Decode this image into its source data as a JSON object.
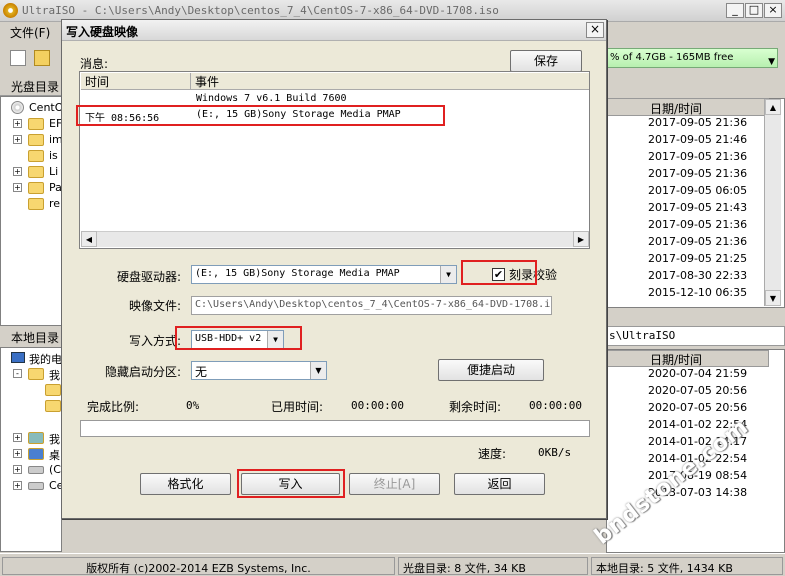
{
  "app": {
    "title": "UltraISO - C:\\Users\\Andy\\Desktop\\centos_7_4\\CentOS-7-x86_64-DVD-1708.iso",
    "menu_file": "文件(F)",
    "window_buttons": [
      "_",
      "□",
      "×"
    ]
  },
  "capacity": {
    "text": "% of 4.7GB - 165MB free",
    "level": 0.96
  },
  "left_top": {
    "header": "光盘目录",
    "root": "CentO",
    "items": [
      "EF",
      "im",
      "is",
      "Li",
      "Pa",
      "re"
    ]
  },
  "left_bottom": {
    "header": "本地目录",
    "items": [
      "我的电",
      "我",
      "",
      "",
      "我",
      "桌",
      "(C",
      "Ce"
    ]
  },
  "right_top": {
    "header": "日期/时间",
    "dates": [
      "2017-09-05 21:36",
      "2017-09-05 21:46",
      "2017-09-05 21:36",
      "2017-09-05 21:36",
      "2017-09-05 06:05",
      "2017-09-05 21:43",
      "2017-09-05 21:36",
      "2017-09-05 21:36",
      "2017-09-05 21:25",
      "2017-08-30 22:33",
      "2015-12-10 06:35"
    ]
  },
  "right_bottom": {
    "path": "s\\UltraISO",
    "header": "日期/时间",
    "dates": [
      "2020-07-04 21:59",
      "2020-07-05 20:56",
      "2020-07-05 20:56",
      "2014-01-02 22:54",
      "2014-01-02 14:17",
      "2014-01-02 22:54",
      "2017-08-19 08:54",
      "2013-07-03 14:38"
    ]
  },
  "status": {
    "copyright": "版权所有 (c)2002-2014 EZB Systems, Inc.",
    "iso_dir": "光盘目录: 8 文件, 34 KB",
    "local_dir": "本地目录: 5 文件, 1434 KB"
  },
  "dialog": {
    "title": "写入硬盘映像",
    "close": "×",
    "messages_label": "消息:",
    "save_button": "保存",
    "log_columns": [
      "时间",
      "事件"
    ],
    "log_rows": [
      {
        "time": "",
        "event": "Windows 7 v6.1 Build 7600"
      },
      {
        "time": "下午 08:56:56",
        "event": "(E:, 15 GB)Sony    Storage Media   PMAP"
      }
    ],
    "drive_label": "硬盘驱动器:",
    "drive_value": "(E:, 15 GB)Sony    Storage Media   PMAP",
    "verify_label": "刻录校验",
    "verify_checked": "✔",
    "image_label": "映像文件:",
    "image_value": "C:\\Users\\Andy\\Desktop\\centos_7_4\\CentOS-7-x86_64-DVD-1708.i",
    "write_method_label": "写入方式:",
    "write_method_value": "USB-HDD+ v2",
    "hidden_label": "隐藏启动分区:",
    "hidden_value": "无",
    "quickboot_button": "便捷启动",
    "progress_label": "完成比例:",
    "progress_value": "0%",
    "progress_fraction": 0,
    "elapsed_label": "已用时间:",
    "elapsed_value": "00:00:00",
    "remaining_label": "剩余时间:",
    "remaining_value": "00:00:00",
    "speed_label": "速度:",
    "speed_value": "0KB/s",
    "format_button": "格式化",
    "write_button": "写入",
    "abort_button": "终止[A]",
    "back_button": "返回"
  },
  "watermark": "bndstone.com",
  "colors": {
    "highlight_box": "#e02020",
    "capacity_bar": "#b8f0b0"
  }
}
